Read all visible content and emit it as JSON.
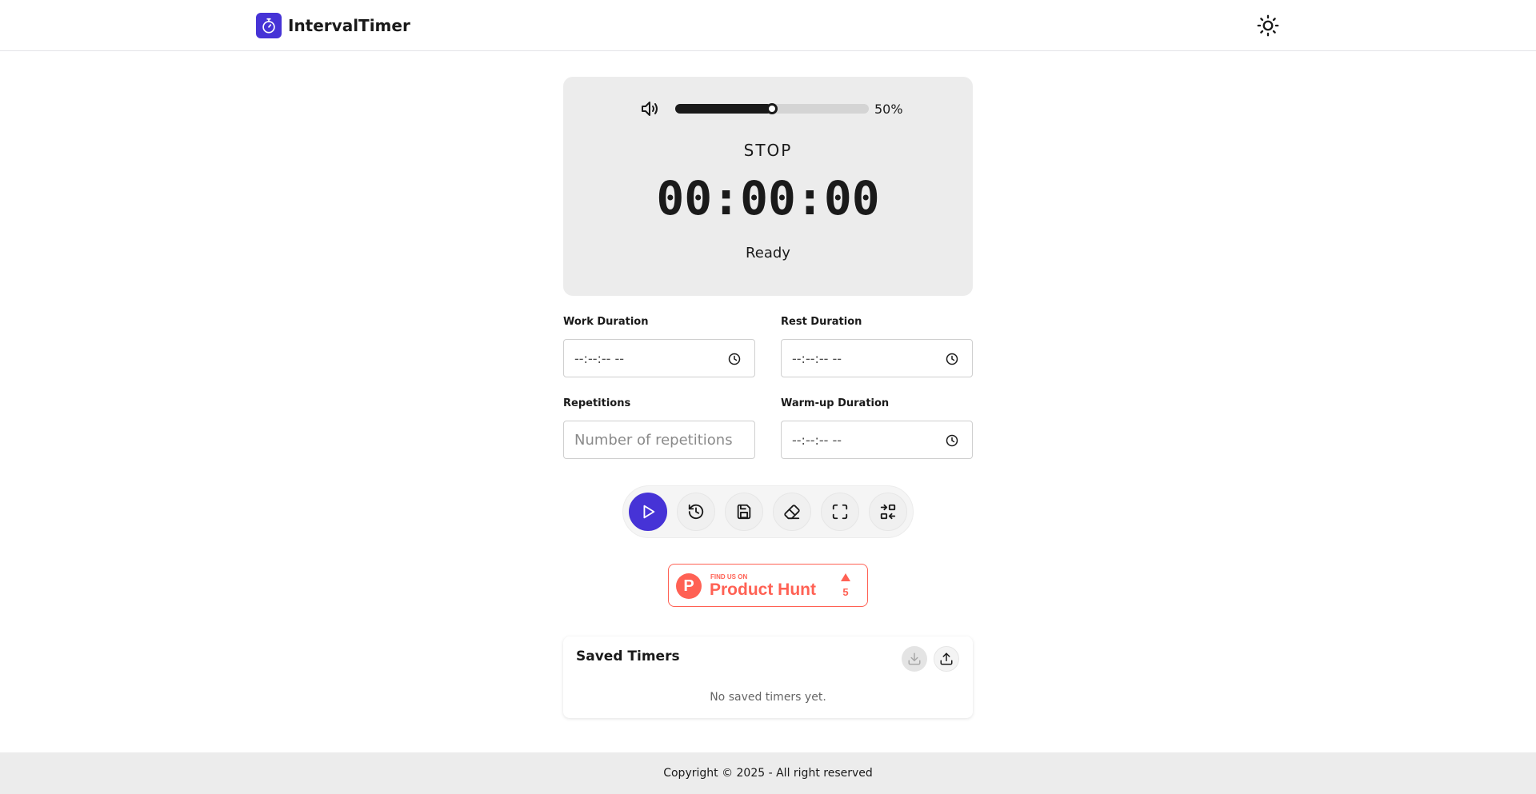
{
  "app": {
    "name": "IntervalTimer",
    "theme_toggle_icon": "sun-icon",
    "accent_color": "#4633d6"
  },
  "timer": {
    "volume_percent": 50,
    "volume_label": "50%",
    "phase": "STOP",
    "clock": "00:00:00",
    "status": "Ready"
  },
  "form": {
    "work": {
      "label": "Work Duration",
      "value": "--:--:-- --"
    },
    "rest": {
      "label": "Rest Duration",
      "value": "--:--:-- --"
    },
    "reps": {
      "label": "Repetitions",
      "placeholder": "Number of repetitions"
    },
    "warmup": {
      "label": "Warm-up Duration",
      "value": "--:--:-- --"
    }
  },
  "controls": [
    {
      "name": "play-button",
      "icon": "play-icon"
    },
    {
      "name": "reset-button",
      "icon": "history-icon"
    },
    {
      "name": "save-button",
      "icon": "save-icon"
    },
    {
      "name": "clear-button",
      "icon": "eraser-icon"
    },
    {
      "name": "fullscreen-button",
      "icon": "fullscreen-icon"
    },
    {
      "name": "swap-button",
      "icon": "swap-icon"
    }
  ],
  "product_hunt": {
    "small": "FIND US ON",
    "big": "Product Hunt",
    "count": "5",
    "color": "#ff6154"
  },
  "saved": {
    "title": "Saved Timers",
    "empty": "No saved timers yet."
  },
  "footer": {
    "text": "Copyright © 2025 - All right reserved"
  }
}
